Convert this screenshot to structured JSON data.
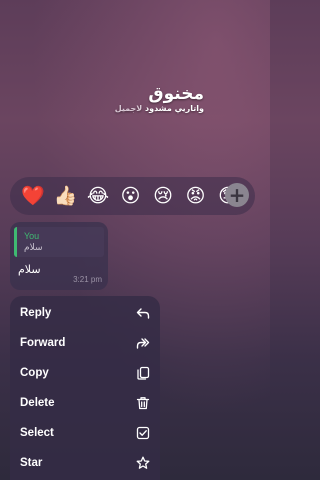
{
  "caption": {
    "title": "مخنوق",
    "subtitle_main": "واتاريي مشدود",
    "subtitle_faint": "لاجميل"
  },
  "reactions": [
    {
      "icon": "heart-icon",
      "glyph": "❤️"
    },
    {
      "icon": "thumbs-up-icon",
      "glyph": "👍🏻"
    },
    {
      "icon": "laughing-tears-icon",
      "glyph": "😂"
    },
    {
      "icon": "surprised-face-icon",
      "glyph": "😮"
    },
    {
      "icon": "crying-face-icon",
      "glyph": "😢"
    },
    {
      "icon": "angry-face-icon",
      "glyph": "😡"
    },
    {
      "icon": "praying-face-icon",
      "glyph": "😓"
    }
  ],
  "add_reaction": {
    "icon": "plus-icon",
    "glyph": "+"
  },
  "message": {
    "quote_author": "You",
    "quote_text": "سلام",
    "text": "سلام",
    "time": "3:21 pm"
  },
  "menu": {
    "items": [
      {
        "label": "Reply",
        "icon": "reply-icon"
      },
      {
        "label": "Forward",
        "icon": "forward-icon"
      },
      {
        "label": "Copy",
        "icon": "copy-icon"
      },
      {
        "label": "Delete",
        "icon": "trash-icon"
      },
      {
        "label": "Select",
        "icon": "checkbox-icon"
      },
      {
        "label": "Star",
        "icon": "star-icon"
      }
    ]
  },
  "colors": {
    "accent_green": "#3fba72",
    "menu_bg": "#342c46",
    "text": "#ffffff"
  }
}
